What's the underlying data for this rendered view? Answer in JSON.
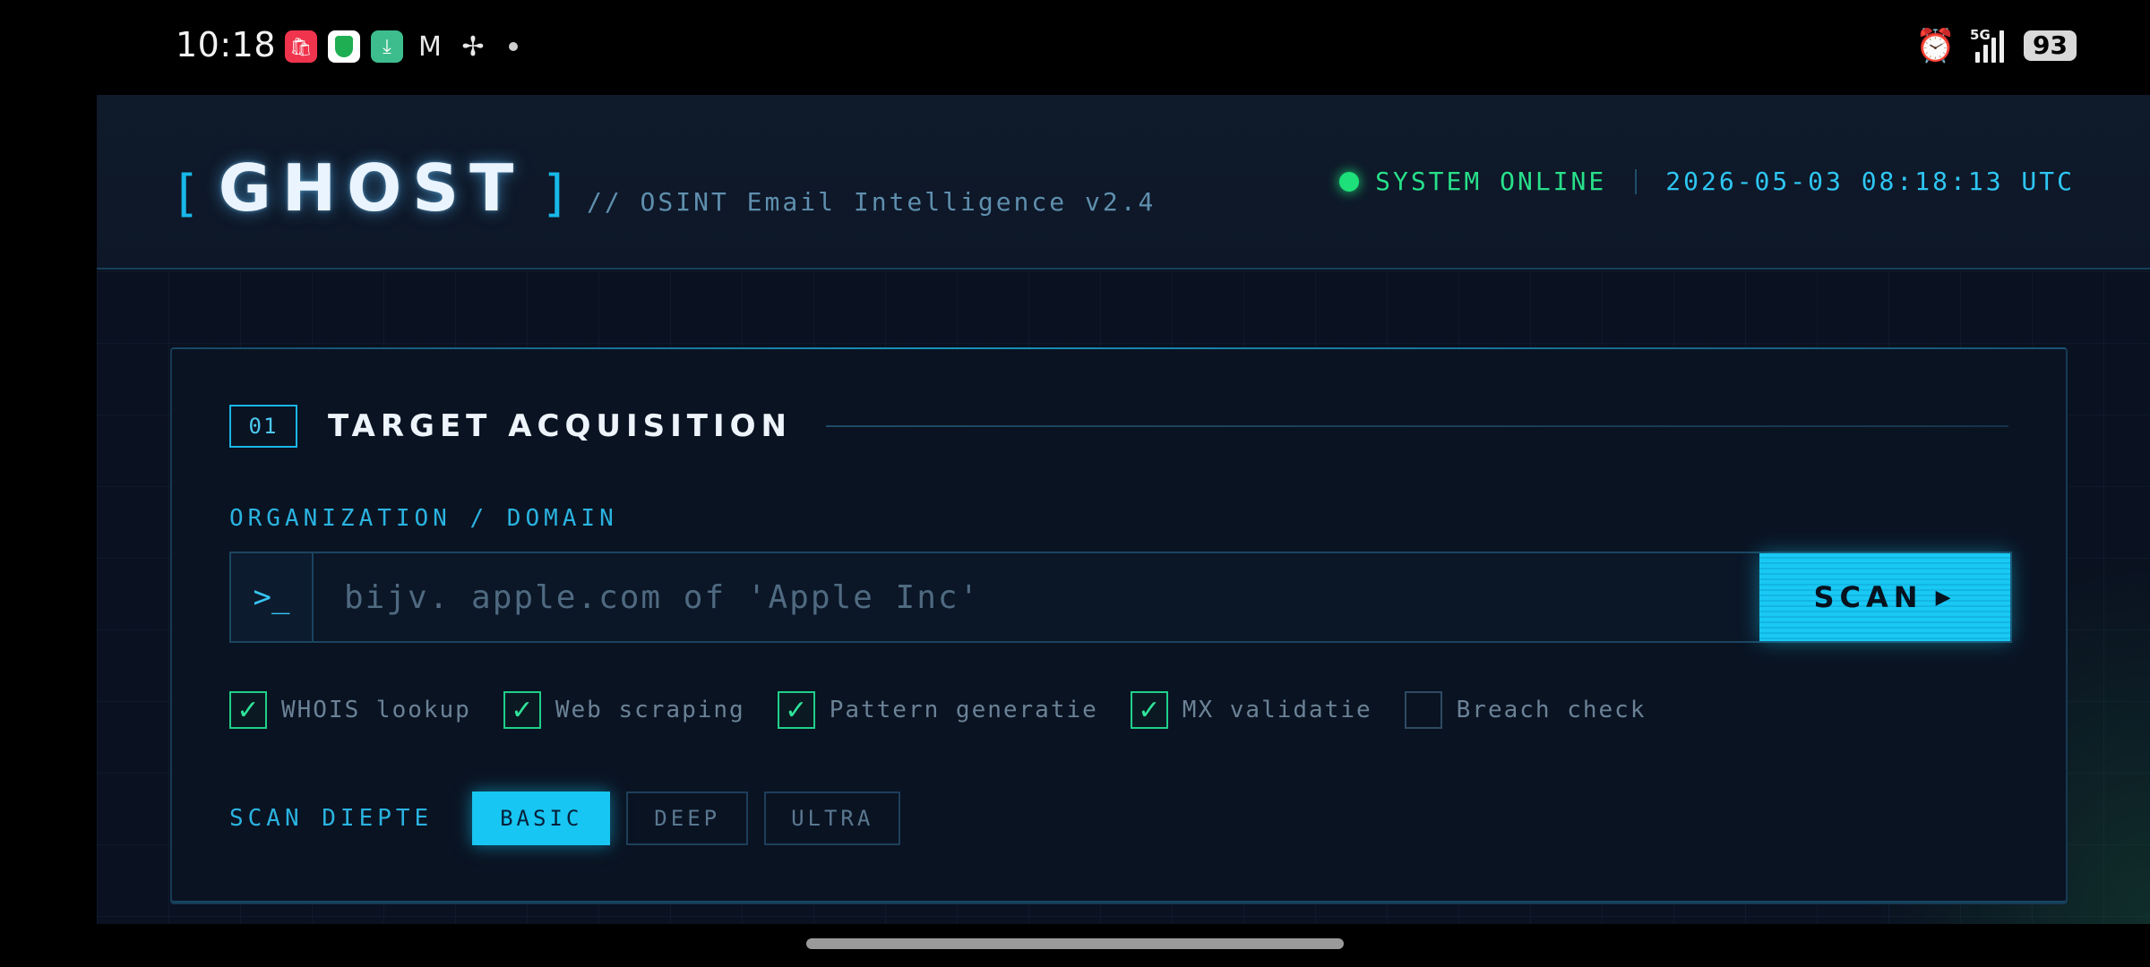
{
  "status_bar": {
    "time": "10:18",
    "app_icons": [
      "shopping-bag-icon",
      "shield-icon",
      "download-icon",
      "gmail-icon",
      "fan-icon"
    ],
    "network": "5G",
    "battery": "93"
  },
  "header": {
    "bracket_open": "[",
    "bracket_close": "]",
    "logo": "GHOST",
    "subtitle": "// OSINT Email Intelligence v2.4",
    "status": "SYSTEM ONLINE",
    "timestamp": "2026-05-03 08:18:13 UTC"
  },
  "section": {
    "number": "01",
    "title": "TARGET ACQUISITION"
  },
  "target": {
    "label": "ORGANIZATION / DOMAIN",
    "prompt": ">_",
    "value": "",
    "placeholder": "bijv. apple.com of 'Apple Inc'",
    "scan_label": "SCAN",
    "scan_arrow": "▶"
  },
  "options": [
    {
      "label": "WHOIS lookup",
      "checked": true
    },
    {
      "label": "Web scraping",
      "checked": true
    },
    {
      "label": "Pattern generatie",
      "checked": true
    },
    {
      "label": "MX validatie",
      "checked": true
    },
    {
      "label": "Breach check",
      "checked": false
    }
  ],
  "depth": {
    "label": "SCAN DIEPTE",
    "levels": [
      "BASIC",
      "DEEP",
      "ULTRA"
    ],
    "selected": "BASIC"
  },
  "colors": {
    "accent": "#18b8e8",
    "online": "#1ee07a",
    "background": "#0b1220"
  }
}
